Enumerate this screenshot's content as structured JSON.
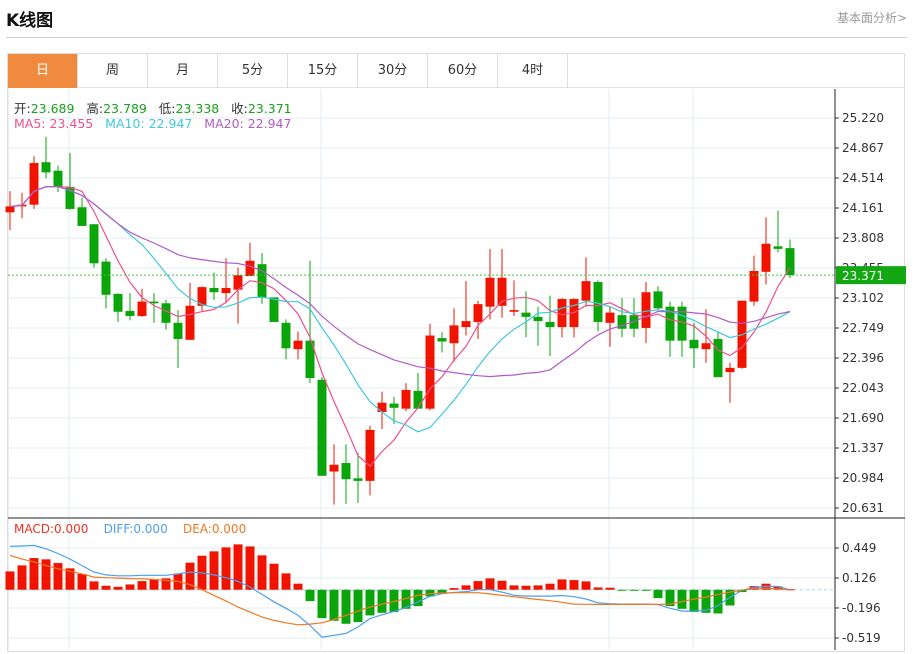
{
  "header": {
    "title": "K线图",
    "fundamental_link": "基本面分析>"
  },
  "tabs": [
    {
      "label": "日",
      "active": true
    },
    {
      "label": "周"
    },
    {
      "label": "月"
    },
    {
      "label": "5分"
    },
    {
      "label": "15分"
    },
    {
      "label": "30分"
    },
    {
      "label": "60分"
    },
    {
      "label": "4时"
    }
  ],
  "ohlc_info": {
    "open_label": "开:",
    "open": "23.689",
    "high_label": "高:",
    "high": "23.789",
    "low_label": "低:",
    "low": "23.338",
    "close_label": "收:",
    "close": "23.371"
  },
  "ma_info": {
    "ma5_label": "MA5:",
    "ma5": "23.455",
    "ma10_label": "MA10:",
    "ma10": "22.947",
    "ma20_label": "MA20:",
    "ma20": "22.947"
  },
  "macd_info": {
    "macd_label": "MACD:",
    "macd": "0.000",
    "diff_label": "DIFF:",
    "diff": "0.000",
    "dea_label": "DEA:",
    "dea": "0.000"
  },
  "colors": {
    "up": "#f01400",
    "down": "#0aa50a",
    "ma5": "#f0508a",
    "ma10": "#40c8e0",
    "ma20": "#b45ac8",
    "diff": "#4aa0f0",
    "dea": "#f07820",
    "tab_active": "#f08a3e"
  },
  "current_price": "23.371",
  "chart_data": {
    "type": "candlestick",
    "price_axis_ticks": [
      "25.220",
      "24.867",
      "24.514",
      "24.161",
      "23.808",
      "23.455",
      "23.102",
      "22.749",
      "22.396",
      "22.043",
      "21.690",
      "21.337",
      "20.984",
      "20.631"
    ],
    "price_range": [
      20.631,
      25.22
    ],
    "candles": [
      [
        24.11,
        24.36,
        23.9,
        24.18
      ],
      [
        24.18,
        24.34,
        24.04,
        24.2
      ],
      [
        24.2,
        24.77,
        24.15,
        24.69
      ],
      [
        24.7,
        25.0,
        24.51,
        24.58
      ],
      [
        24.6,
        24.66,
        24.35,
        24.41
      ],
      [
        24.41,
        24.81,
        24.14,
        24.15
      ],
      [
        24.17,
        24.28,
        23.95,
        23.95
      ],
      [
        23.97,
        23.97,
        23.46,
        23.51
      ],
      [
        23.53,
        23.57,
        22.98,
        23.14
      ],
      [
        23.15,
        23.16,
        22.82,
        22.94
      ],
      [
        22.95,
        23.16,
        22.84,
        22.89
      ],
      [
        22.89,
        23.21,
        22.88,
        23.06
      ],
      [
        23.06,
        23.16,
        22.81,
        23.04
      ],
      [
        23.04,
        23.08,
        22.73,
        22.81
      ],
      [
        22.81,
        22.96,
        22.28,
        22.62
      ],
      [
        22.61,
        23.28,
        22.61,
        23.01
      ],
      [
        23.01,
        23.24,
        22.94,
        23.23
      ],
      [
        23.22,
        23.4,
        23.08,
        23.17
      ],
      [
        23.16,
        23.57,
        23.04,
        23.22
      ],
      [
        23.2,
        23.46,
        22.8,
        23.37
      ],
      [
        23.36,
        23.75,
        23.36,
        23.54
      ],
      [
        23.5,
        23.63,
        23.03,
        23.11
      ],
      [
        23.11,
        23.11,
        22.82,
        22.82
      ],
      [
        22.81,
        22.85,
        22.38,
        22.51
      ],
      [
        22.5,
        22.71,
        22.38,
        22.6
      ],
      [
        22.6,
        23.54,
        22.1,
        22.16
      ],
      [
        22.14,
        22.17,
        21.01,
        21.01
      ],
      [
        21.06,
        21.38,
        20.67,
        21.14
      ],
      [
        21.16,
        21.38,
        20.68,
        20.97
      ],
      [
        20.98,
        21.28,
        20.69,
        20.95
      ],
      [
        20.95,
        21.6,
        20.78,
        21.55
      ],
      [
        21.76,
        22.0,
        21.56,
        21.87
      ],
      [
        21.86,
        21.94,
        21.62,
        21.81
      ],
      [
        21.8,
        22.1,
        21.77,
        22.02
      ],
      [
        22.01,
        22.22,
        21.8,
        21.8
      ],
      [
        21.8,
        22.8,
        21.78,
        22.66
      ],
      [
        22.63,
        22.7,
        22.46,
        22.59
      ],
      [
        22.57,
        22.98,
        22.35,
        22.78
      ],
      [
        22.76,
        23.3,
        22.66,
        22.83
      ],
      [
        22.82,
        23.07,
        22.62,
        23.03
      ],
      [
        23.0,
        23.68,
        22.85,
        23.34
      ],
      [
        23.01,
        23.68,
        22.87,
        23.34
      ],
      [
        22.94,
        23.31,
        22.89,
        22.96
      ],
      [
        22.93,
        23.18,
        22.64,
        22.88
      ],
      [
        22.88,
        23.0,
        22.54,
        22.83
      ],
      [
        22.82,
        23.13,
        22.42,
        22.76
      ],
      [
        22.76,
        23.1,
        22.64,
        23.09
      ],
      [
        22.76,
        23.1,
        22.64,
        23.09
      ],
      [
        23.07,
        23.58,
        23.0,
        23.3
      ],
      [
        23.29,
        23.31,
        22.71,
        22.82
      ],
      [
        22.81,
        23.0,
        22.53,
        22.93
      ],
      [
        22.9,
        23.1,
        22.64,
        22.74
      ],
      [
        22.9,
        23.1,
        22.64,
        22.74
      ],
      [
        22.75,
        23.29,
        22.57,
        23.17
      ],
      [
        23.18,
        23.24,
        22.97,
        22.98
      ],
      [
        23.0,
        23.06,
        22.41,
        22.6
      ],
      [
        23.0,
        23.06,
        22.41,
        22.6
      ],
      [
        22.61,
        22.81,
        22.28,
        22.51
      ],
      [
        22.5,
        22.97,
        22.34,
        22.57
      ],
      [
        22.62,
        22.7,
        22.21,
        22.17
      ],
      [
        22.23,
        22.34,
        21.87,
        22.28
      ],
      [
        22.28,
        23.07,
        22.27,
        23.07
      ],
      [
        23.06,
        23.6,
        23.01,
        23.42
      ],
      [
        23.41,
        24.05,
        23.26,
        23.74
      ],
      [
        23.71,
        24.13,
        23.64,
        23.68
      ],
      [
        23.689,
        23.789,
        23.338,
        23.371
      ]
    ],
    "macd_axis_ticks": [
      "0.449",
      "0.126",
      "-0.196",
      "-0.519"
    ],
    "macd_range": [
      -0.519,
      0.449
    ],
    "macd_hist": [
      0.197,
      0.262,
      0.341,
      0.327,
      0.287,
      0.23,
      0.169,
      0.09,
      0.043,
      0.032,
      0.057,
      0.093,
      0.111,
      0.122,
      0.172,
      0.291,
      0.366,
      0.413,
      0.456,
      0.488,
      0.466,
      0.37,
      0.28,
      0.176,
      0.065,
      -0.122,
      -0.305,
      -0.334,
      -0.366,
      -0.348,
      -0.276,
      -0.248,
      -0.24,
      -0.205,
      -0.176,
      -0.072,
      -0.043,
      0.018,
      0.047,
      0.093,
      0.122,
      0.097,
      0.047,
      0.043,
      0.047,
      0.065,
      0.111,
      0.104,
      0.09,
      0.025,
      0.022,
      -0.003,
      -0.003,
      -0.003,
      -0.09,
      -0.176,
      -0.205,
      -0.24,
      -0.248,
      -0.255,
      -0.169,
      -0.025,
      0.039,
      0.065,
      0.036,
      0.005
    ],
    "diff": [
      0.466,
      0.47,
      0.477,
      0.44,
      0.39,
      0.33,
      0.26,
      0.19,
      0.16,
      0.15,
      0.15,
      0.155,
      0.155,
      0.155,
      0.17,
      0.19,
      0.18,
      0.16,
      0.13,
      0.09,
      0.03,
      -0.05,
      -0.13,
      -0.2,
      -0.276,
      -0.384,
      -0.51,
      -0.49,
      -0.47,
      -0.4,
      -0.31,
      -0.27,
      -0.233,
      -0.19,
      -0.13,
      -0.072,
      -0.043,
      -0.03,
      -0.02,
      0,
      0,
      -0.025,
      -0.06,
      -0.068,
      -0.068,
      -0.068,
      -0.062,
      -0.075,
      -0.1,
      -0.14,
      -0.15,
      -0.154,
      -0.154,
      -0.154,
      -0.16,
      -0.2,
      -0.23,
      -0.23,
      -0.222,
      -0.17,
      -0.08,
      -0.007,
      0.025,
      0.039,
      0.035,
      0
    ],
    "dea": [
      0.37,
      0.33,
      0.3,
      0.26,
      0.226,
      0.2,
      0.17,
      0.136,
      0.13,
      0.125,
      0.12,
      0.118,
      0.11,
      0.1,
      0.09,
      0.054,
      0,
      -0.061,
      -0.12,
      -0.187,
      -0.24,
      -0.294,
      -0.33,
      -0.355,
      -0.377,
      -0.37,
      -0.355,
      -0.32,
      -0.276,
      -0.23,
      -0.187,
      -0.155,
      -0.126,
      -0.095,
      -0.061,
      -0.043,
      -0.035,
      -0.032,
      -0.032,
      -0.032,
      -0.045,
      -0.061,
      -0.075,
      -0.09,
      -0.105,
      -0.118,
      -0.135,
      -0.154,
      -0.156,
      -0.158,
      -0.158,
      -0.158,
      -0.158,
      -0.158,
      -0.158,
      -0.154,
      -0.126,
      -0.1,
      -0.079,
      -0.05,
      -0.025,
      -0.005,
      0.011,
      0.018,
      0.01,
      0
    ]
  }
}
